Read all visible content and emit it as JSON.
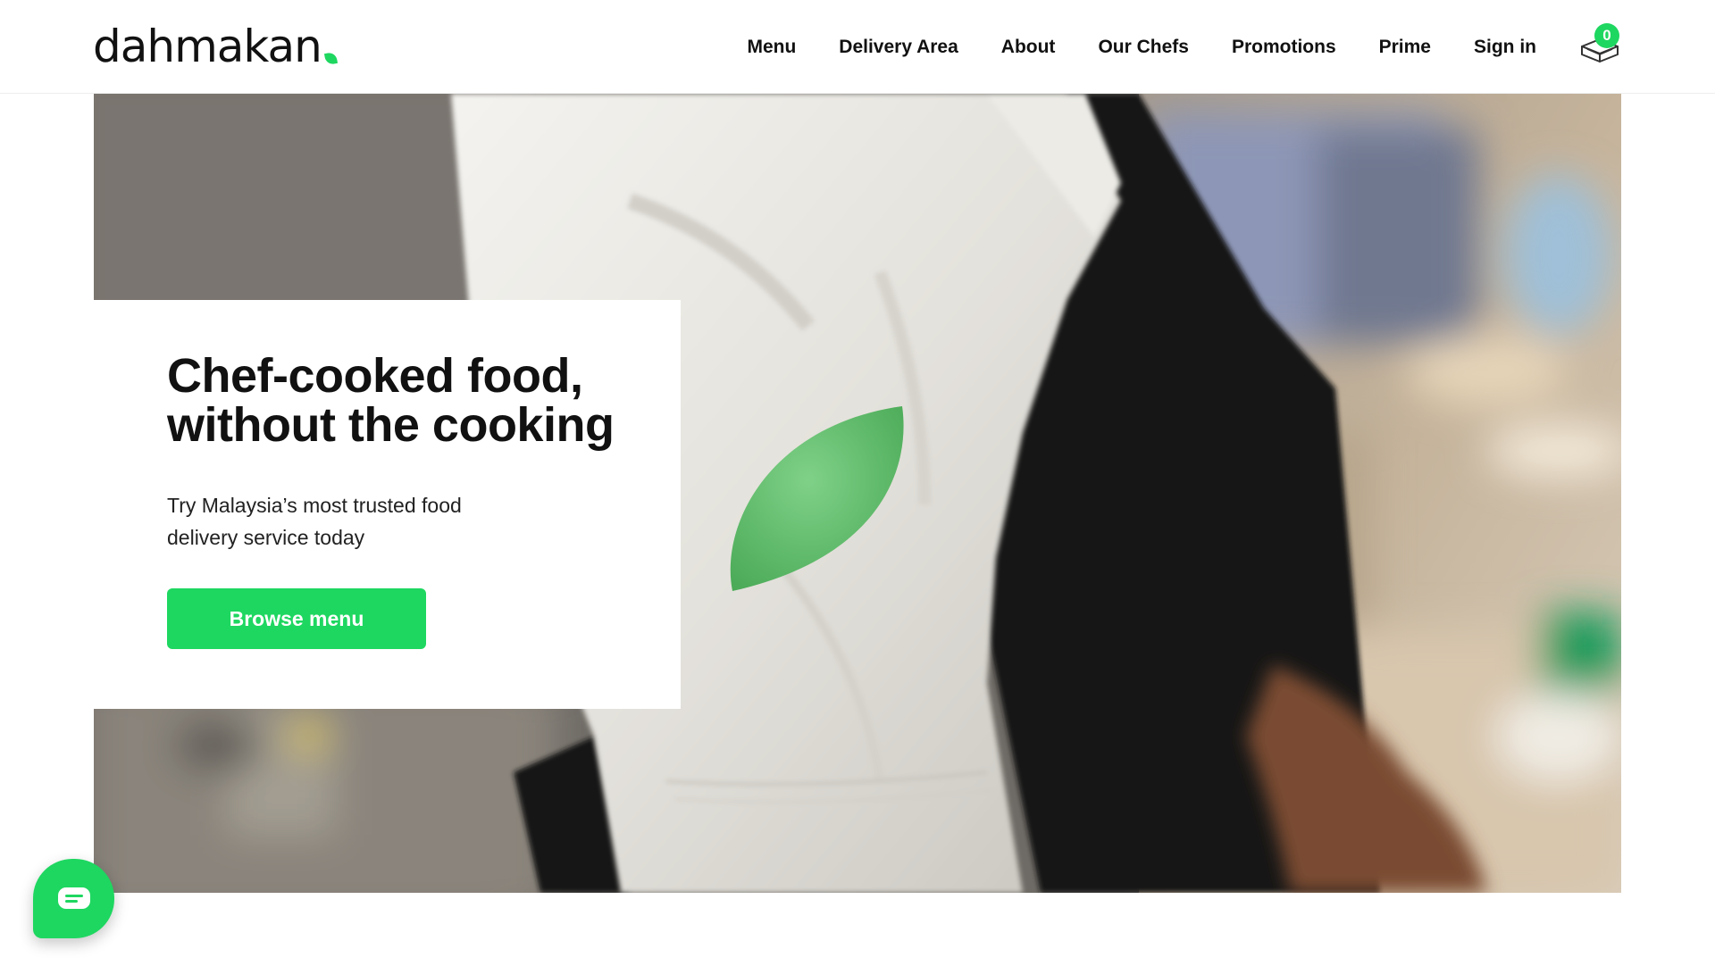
{
  "brand": {
    "name": "dahmakan",
    "accent_color": "#1ed760"
  },
  "nav": {
    "items": [
      {
        "label": "Menu"
      },
      {
        "label": "Delivery Area"
      },
      {
        "label": "About"
      },
      {
        "label": "Our Chefs"
      },
      {
        "label": "Promotions"
      },
      {
        "label": "Prime"
      },
      {
        "label": "Sign in"
      }
    ]
  },
  "cart": {
    "icon": "food-box-icon",
    "count": "0"
  },
  "hero": {
    "image": "chef-uniform-with-green-leaf-patch",
    "title_line1": "Chef-cooked food,",
    "title_line2": "without the cooking",
    "subtitle_line1": "Try Malaysia’s most trusted food",
    "subtitle_line2": "delivery service today",
    "cta_label": "Browse menu"
  },
  "chat": {
    "icon": "chat-bubble-icon"
  }
}
